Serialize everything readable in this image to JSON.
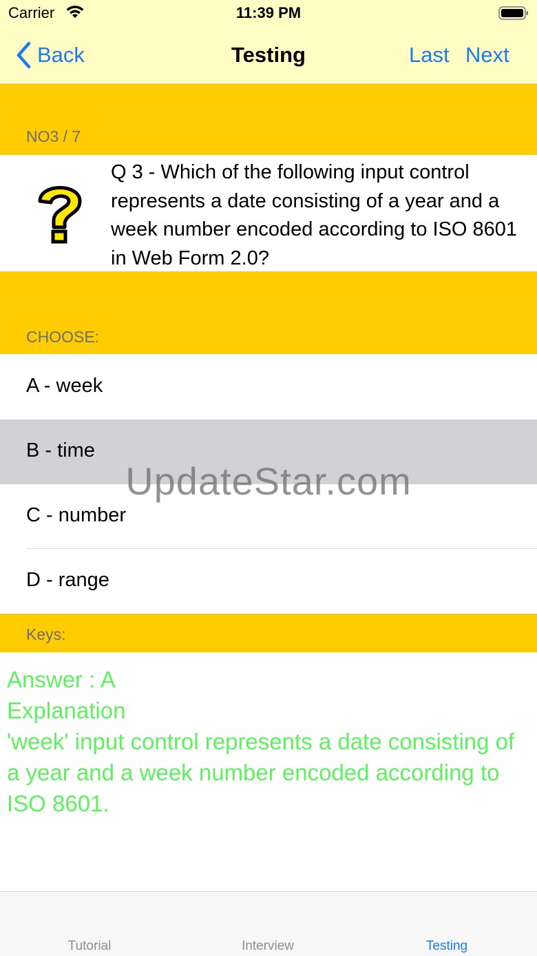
{
  "status_bar": {
    "carrier": "Carrier",
    "time": "11:39 PM"
  },
  "nav": {
    "back_label": "Back",
    "title": "Testing",
    "last_label": "Last",
    "next_label": "Next"
  },
  "question": {
    "header": "NO3 / 7",
    "text": "Q 3 - Which of the following input control represents a date consisting of a year and a week number encoded according to ISO 8601 in Web Form 2.0?",
    "icon": "question-mark-icon"
  },
  "choose": {
    "header": "CHOOSE:",
    "options": [
      {
        "label": "A - week"
      },
      {
        "label": "B - time",
        "selected": true
      },
      {
        "label": "C - number"
      },
      {
        "label": "D - range"
      }
    ]
  },
  "keys": {
    "header": "Keys:",
    "answer": "Answer : A",
    "explanation_title": "Explanation",
    "explanation": "'week' input control represents a date consisting of a year and a week number encoded according to ISO 8601."
  },
  "watermark": "UpdateStar.com",
  "tabs": [
    {
      "label": "Tutorial"
    },
    {
      "label": "Interview"
    },
    {
      "label": "Testing",
      "active": true
    }
  ],
  "colors": {
    "nav_background": "#fffcc4",
    "section_header": "#ffcc00",
    "accent": "#1a7cf0",
    "answer_text": "#5ef05e",
    "selected_row": "#d1d1d6"
  }
}
